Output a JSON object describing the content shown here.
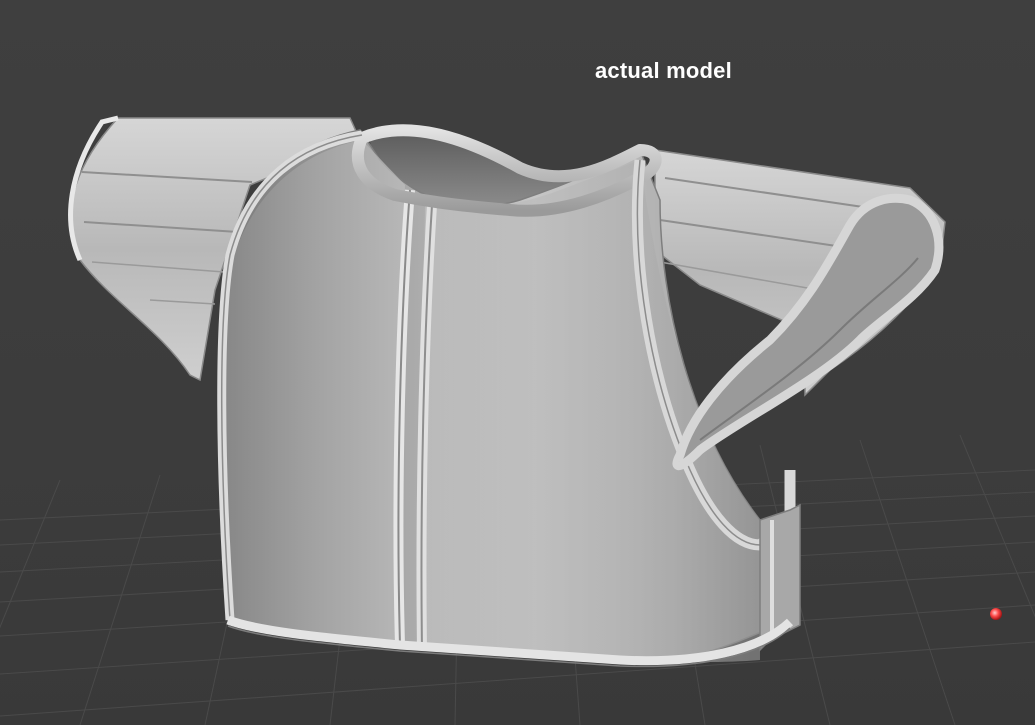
{
  "viewport": {
    "caption": "actual model",
    "background_color": "#3d3d3d",
    "grid_color": "#4a4a4a",
    "model_color": "#b4b4b4",
    "pivot_marker_color": "#ff4a4a"
  },
  "icons": {
    "pivot": "pivot-point-marker"
  }
}
